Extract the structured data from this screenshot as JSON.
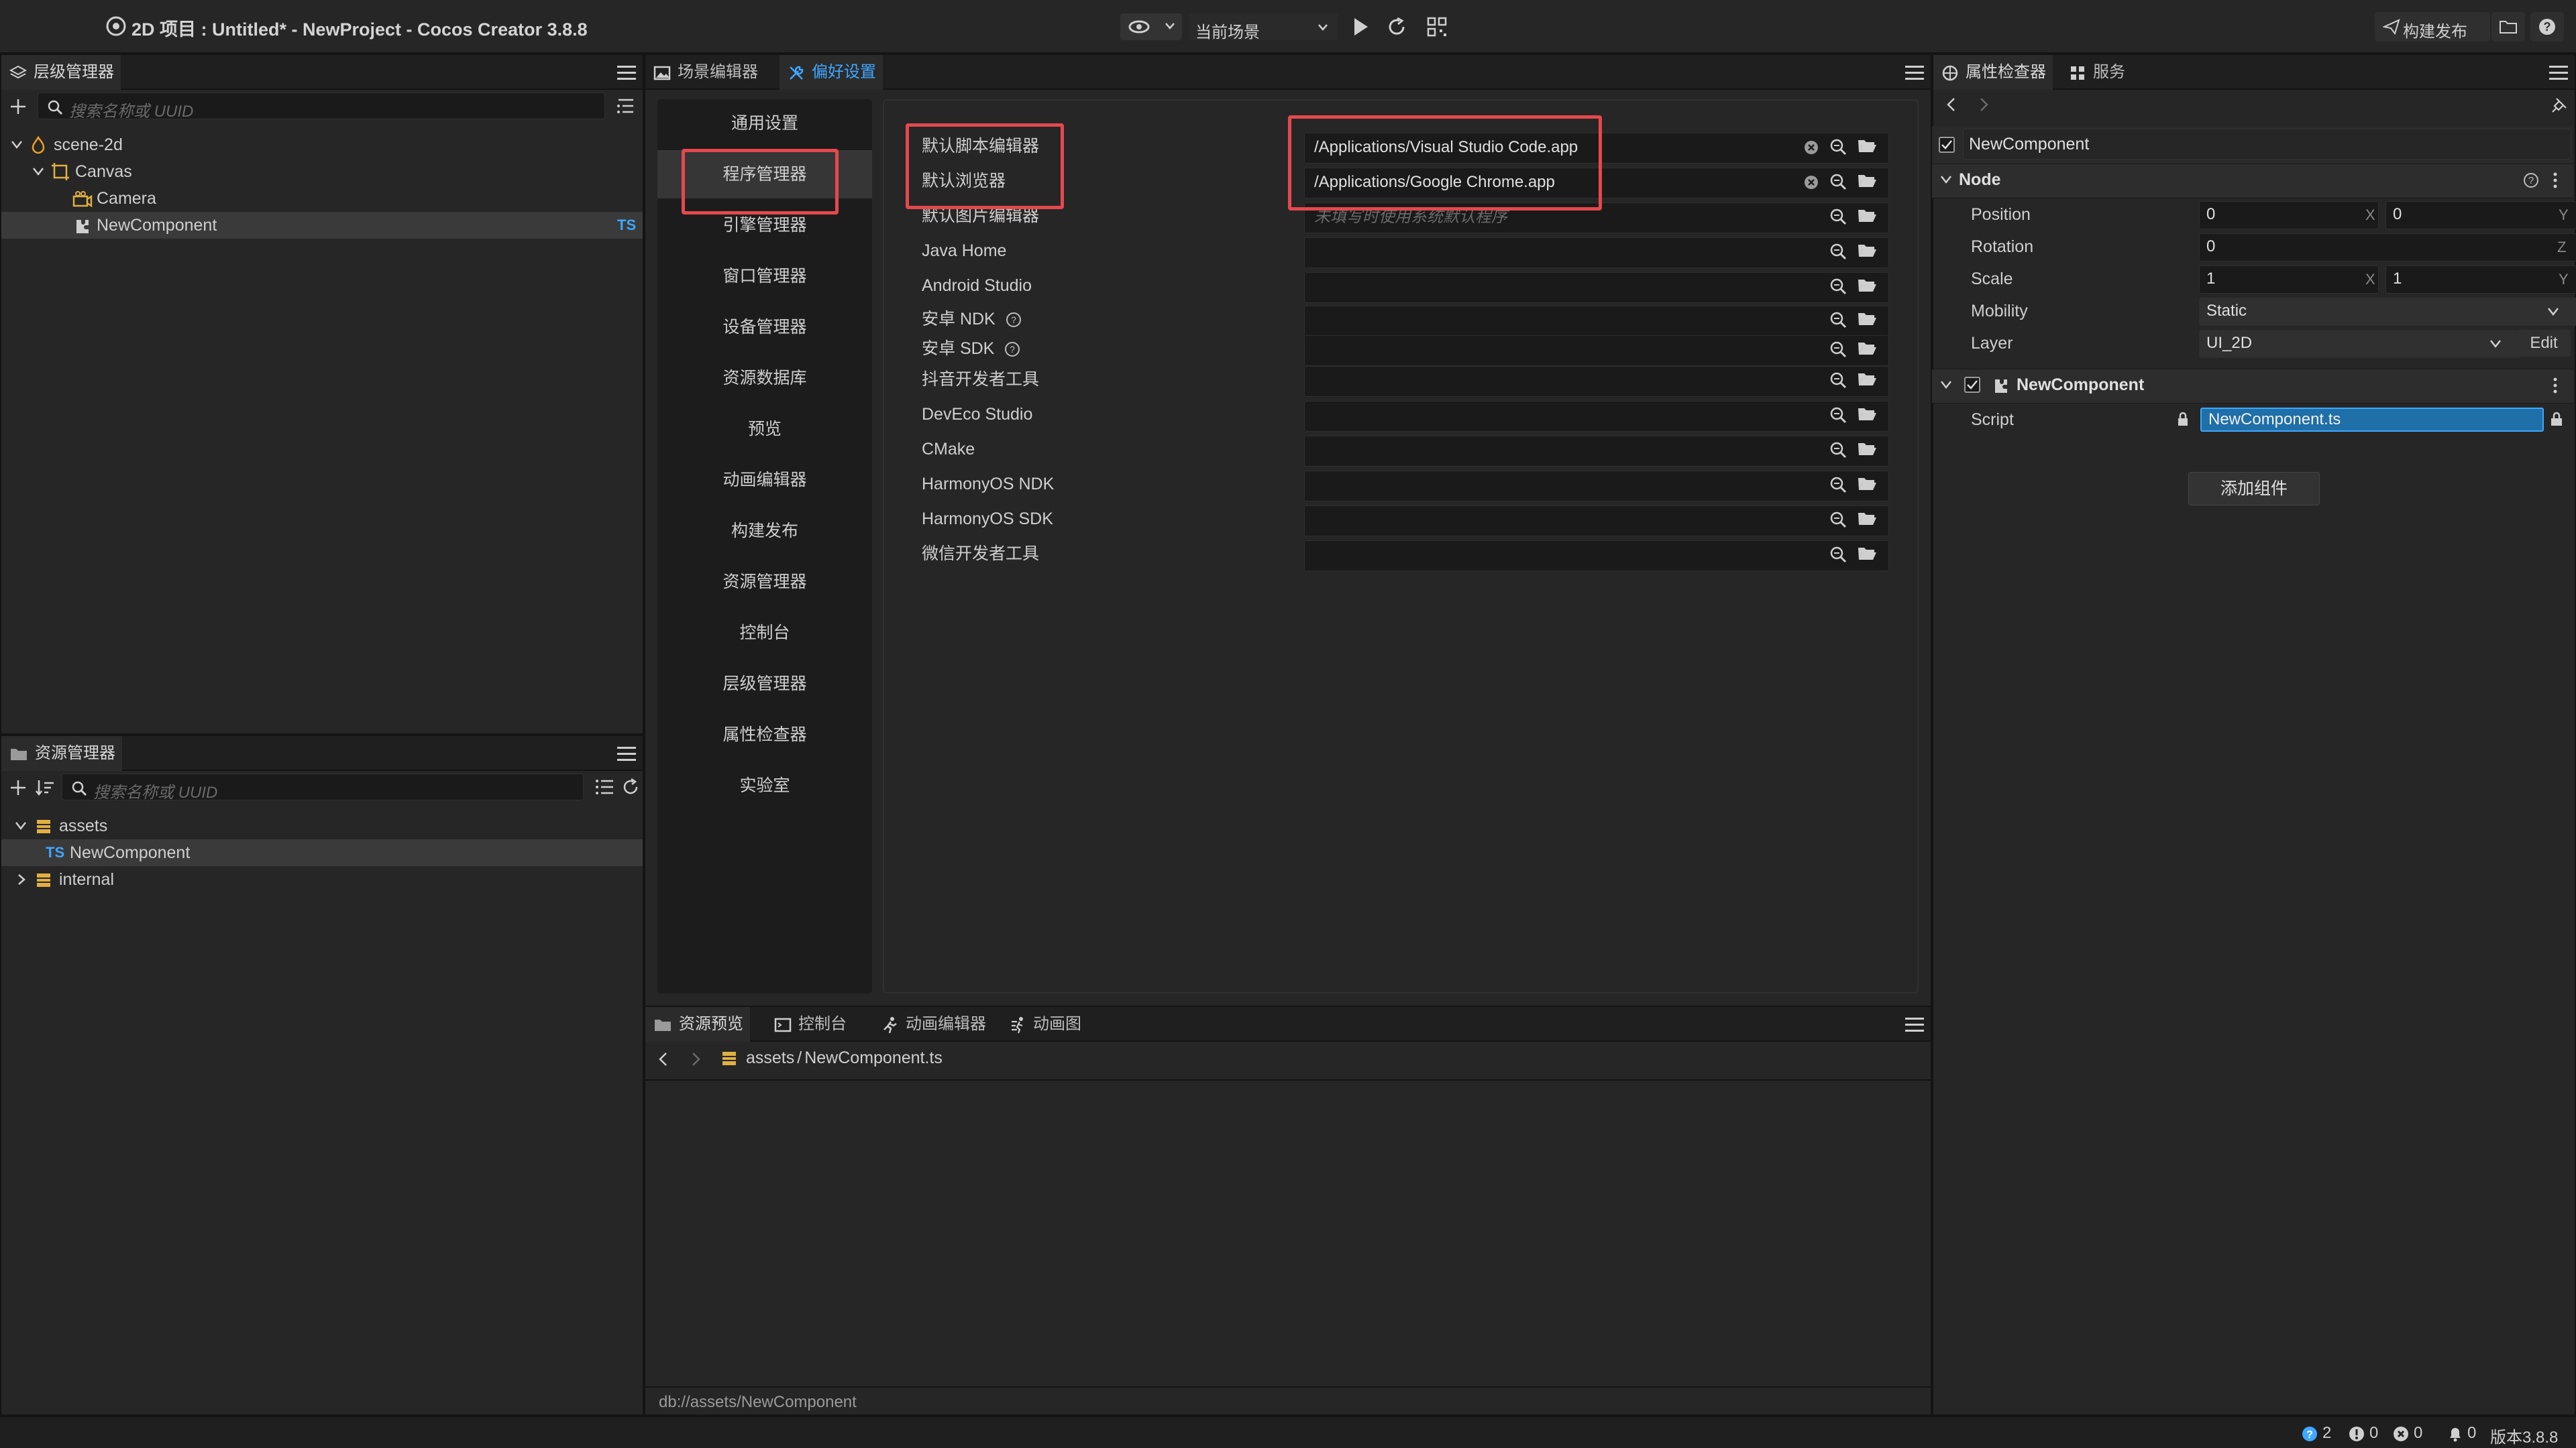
{
  "window": {
    "title": "2D 项目 : Untitled* - NewProject - Cocos Creator 3.8.8",
    "scene_select": "当前场景",
    "build_publish": "构建发布"
  },
  "hierarchy": {
    "tab": "层级管理器",
    "search_placeholder": "搜索名称或 UUID",
    "items": [
      {
        "label": "scene-2d"
      },
      {
        "label": "Canvas"
      },
      {
        "label": "Camera"
      },
      {
        "label": "NewComponent",
        "badge": "TS"
      }
    ]
  },
  "assets": {
    "tab": "资源管理器",
    "search_placeholder": "搜索名称或 UUID",
    "items": [
      {
        "label": "assets"
      },
      {
        "label": "NewComponent",
        "badge": "TS"
      },
      {
        "label": "internal"
      }
    ]
  },
  "center_tabs": [
    "场景编辑器",
    "偏好设置"
  ],
  "preferences": {
    "nav": [
      "通用设置",
      "程序管理器",
      "引擎管理器",
      "窗口管理器",
      "设备管理器",
      "资源数据库",
      "预览",
      "动画编辑器",
      "构建发布",
      "资源管理器",
      "控制台",
      "层级管理器",
      "属性检查器",
      "实验室"
    ],
    "selected_nav": "程序管理器",
    "rows": [
      {
        "label": "默认脚本编辑器",
        "value": "/Applications/Visual Studio Code.app"
      },
      {
        "label": "默认浏览器",
        "value": "/Applications/Google Chrome.app"
      },
      {
        "label": "默认图片编辑器",
        "placeholder": "未填写时使用系统默认程序"
      },
      {
        "label": "Java Home",
        "value": ""
      },
      {
        "label": "Android Studio",
        "value": ""
      },
      {
        "label": "安卓 NDK",
        "value": ""
      },
      {
        "label": "安卓 SDK",
        "value": ""
      },
      {
        "label": "抖音开发者工具",
        "value": ""
      },
      {
        "label": "DevEco Studio",
        "value": ""
      },
      {
        "label": "CMake",
        "value": ""
      },
      {
        "label": "HarmonyOS NDK",
        "value": ""
      },
      {
        "label": "HarmonyOS SDK",
        "value": ""
      },
      {
        "label": "微信开发者工具",
        "value": ""
      }
    ]
  },
  "bottom_panel": {
    "tabs": [
      "资源预览",
      "控制台",
      "动画编辑器",
      "动画图"
    ],
    "breadcrumb_root": "assets",
    "breadcrumb_sep": "/",
    "breadcrumb_file": "NewComponent.ts",
    "footer_path": "db://assets/NewComponent"
  },
  "inspector": {
    "tabs": [
      "属性检查器",
      "服务"
    ],
    "node_name": "NewComponent",
    "node_section": "Node",
    "position_label": "Position",
    "position_x": "0",
    "position_y": "0",
    "rotation_label": "Rotation",
    "rotation_z": "0",
    "scale_label": "Scale",
    "scale_x": "1",
    "scale_y": "1",
    "mobility_label": "Mobility",
    "mobility_value": "Static",
    "layer_label": "Layer",
    "layer_value": "UI_2D",
    "edit_label": "Edit",
    "component_section": "NewComponent",
    "script_label": "Script",
    "script_value": "NewComponent.ts",
    "add_component": "添加组件",
    "axis_x": "X",
    "axis_y": "Y",
    "axis_z": "Z"
  },
  "status": {
    "info_count": "2",
    "warn_count": "0",
    "error_count": "0",
    "notify_count": "0",
    "version": "版本3.8.8"
  },
  "colors": {
    "accent": "#3fa7ff",
    "highlight_box": "#e5484d",
    "script_bg": "#1f6fa8"
  }
}
